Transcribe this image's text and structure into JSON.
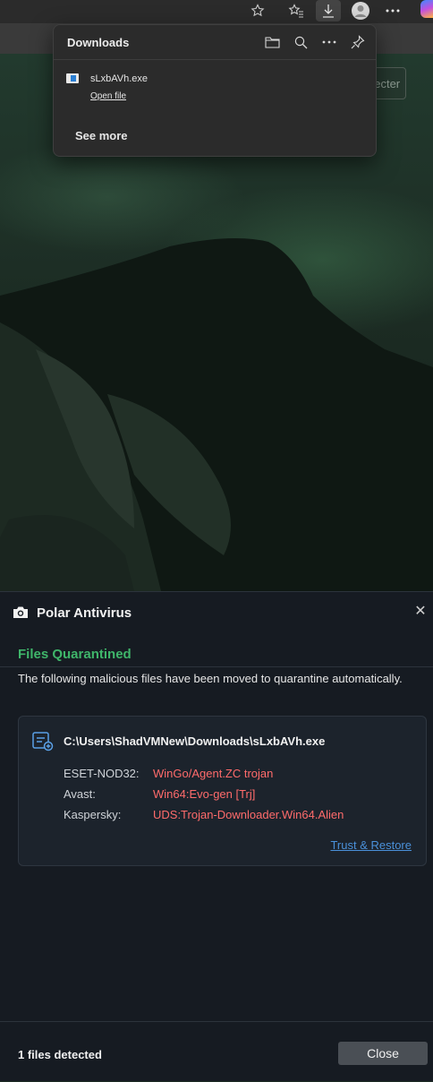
{
  "browser": {
    "toolbar_icons": [
      "star-outline-icon",
      "favorites-icon",
      "download-icon",
      "profile-icon",
      "more-icon"
    ]
  },
  "background": {
    "button_text": "necter"
  },
  "downloads": {
    "title": "Downloads",
    "file": {
      "name": "sLxbAVh.exe",
      "action": "Open file"
    },
    "see_more": "See more",
    "header_icons": [
      "folder-icon",
      "search-icon",
      "more-icon",
      "pin-icon"
    ]
  },
  "antivirus": {
    "app_title": "Polar Antivirus",
    "heading": "Files Quarantined",
    "heading_color": "#3fb56a",
    "description": "The following malicious files have been moved to quarantine automatically.",
    "file_path": "C:\\Users\\ShadVMNew\\Downloads\\sLxbAVh.exe",
    "detections": [
      {
        "engine": "ESET-NOD32:",
        "threat": "WinGo/Agent.ZC trojan"
      },
      {
        "engine": "Avast:",
        "threat": "Win64:Evo-gen [Trj]"
      },
      {
        "engine": "Kaspersky:",
        "threat": "UDS:Trojan-Downloader.Win64.Alien"
      }
    ],
    "threat_color": "#ff6b6b",
    "trust_link": "Trust & Restore",
    "footer_count": "1 files detected",
    "close_button": "Close"
  }
}
